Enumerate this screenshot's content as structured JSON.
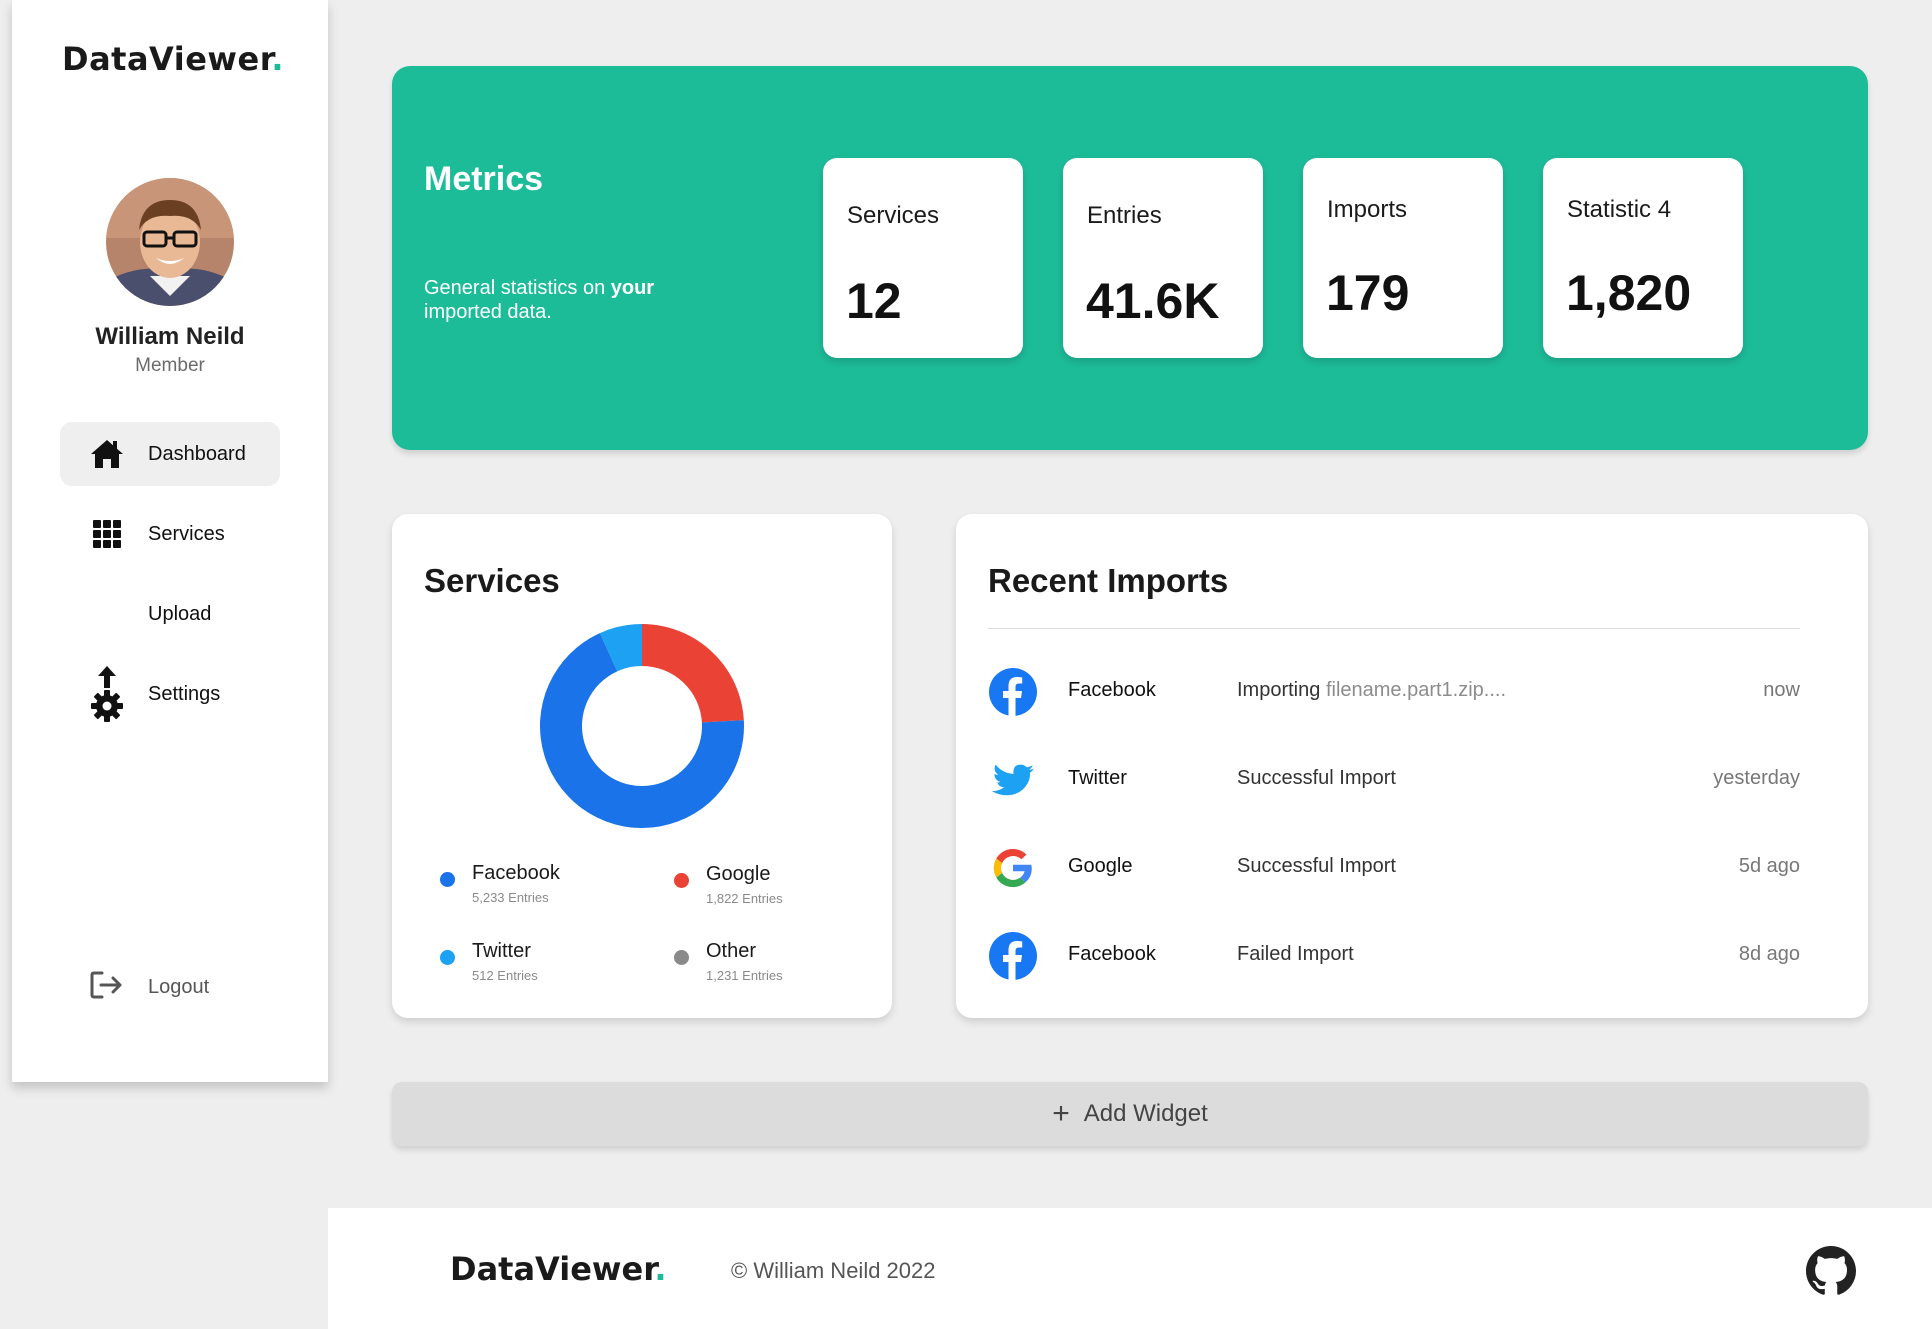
{
  "brand": {
    "name": "DataViewer",
    "dot": "."
  },
  "user": {
    "name": "William Neild",
    "role": "Member"
  },
  "nav": [
    {
      "label": "Dashboard",
      "icon": "home-icon",
      "active": true
    },
    {
      "label": "Services",
      "icon": "grid-icon",
      "active": false
    },
    {
      "label": "Upload",
      "icon": "",
      "active": false
    },
    {
      "label": "Settings",
      "icon": "settings-upload-icon",
      "active": false
    }
  ],
  "logout": {
    "label": "Logout",
    "icon": "logout-icon"
  },
  "metrics": {
    "title": "Metrics",
    "subtitle_pre": "General statistics on ",
    "subtitle_bold": "your",
    "subtitle_post": " imported data.",
    "cards": [
      {
        "label": "Services",
        "value": "12"
      },
      {
        "label": "Entries",
        "value": "41.6K"
      },
      {
        "label": "Imports",
        "value": "179"
      },
      {
        "label": "Statistic 4",
        "value": "1,820"
      }
    ]
  },
  "services": {
    "title": "Services",
    "legend": [
      {
        "name": "Facebook",
        "count": "5,233 Entries",
        "color": "#1a73e8"
      },
      {
        "name": "Google",
        "count": "1,822 Entries",
        "color": "#ea4335"
      },
      {
        "name": "Twitter",
        "count": "512 Entries",
        "color": "#1da1f2"
      },
      {
        "name": "Other",
        "count": "1,231 Entries",
        "color": "#8a8a8a"
      }
    ]
  },
  "chart_data": {
    "type": "pie",
    "donut": true,
    "categories": [
      "Google",
      "Facebook",
      "Twitter"
    ],
    "values": [
      1822,
      5233,
      512
    ],
    "colors": [
      "#ea4335",
      "#1a73e8",
      "#1da1f2"
    ]
  },
  "imports": {
    "title": "Recent Imports",
    "rows": [
      {
        "icon": "facebook-icon",
        "service": "Facebook",
        "status": "Importing ",
        "file": "filename.part1.zip....",
        "time": "now"
      },
      {
        "icon": "twitter-icon",
        "service": "Twitter",
        "status": "Successful Import",
        "file": "",
        "time": "yesterday"
      },
      {
        "icon": "google-icon",
        "service": "Google",
        "status": "Successful Import",
        "file": "",
        "time": "5d ago"
      },
      {
        "icon": "facebook-icon",
        "service": "Facebook",
        "status": "Failed Import",
        "file": "",
        "time": "8d ago"
      }
    ]
  },
  "add_widget": {
    "label": "Add Widget",
    "icon": "plus-icon"
  },
  "footer": {
    "brand": "DataViewer",
    "dot": ".",
    "copyright": "© William Neild 2022",
    "icon": "github-icon"
  },
  "colors": {
    "accent": "#1dbc99",
    "background": "#eeeeee"
  }
}
